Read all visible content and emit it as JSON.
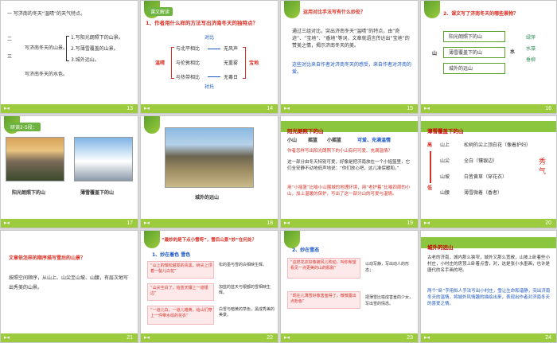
{
  "slides": [
    {
      "num": "13",
      "lines": [
        "一  写济南的冬天“温晴”的天气特点。",
        "二",
        "三",
        "写济南冬天的山景。",
        "1.写阳光朗照下的山景。",
        "2.写薄雪覆盖的山景。",
        "3.城外远山。",
        "写济南冬天的水色。"
      ]
    },
    {
      "num": "14",
      "tag": "课文解读",
      "question": "1、作者用什么样的方法写出济南冬天的独特点？",
      "center": "温晴",
      "rows": [
        "与北平相比",
        "与伦敦相比",
        "与热带相比"
      ],
      "results": [
        "无风声",
        "无重雾",
        "无毒日"
      ],
      "top": "对比",
      "bottom": "衬托",
      "right": "宝地"
    },
    {
      "num": "15",
      "title": "运用对比手法写有什么妙处？",
      "body1": "通过三组对比，突出济南冬天“温晴”的特点，由“奇迹”、“宝地”、“香地”等词，文章就语言传达出“宝地”的赞美之情，揭示济南冬天的美。",
      "body2": "这些对比来自作者对济南冬天的感受，来自作者对济南的爱。"
    },
    {
      "num": "16",
      "title": "2、课文写了济南冬天的哪些景物？",
      "items": [
        "阳光朗照下的山",
        "薄雪覆盖下的山",
        "城外的远山"
      ],
      "left": "山",
      "mid": "水",
      "right": [
        "绿萍",
        "水藻",
        "垂柳"
      ]
    },
    {
      "num": "17",
      "tag": "研读2-5段：",
      "cap1": "阳光朗照下的山",
      "cap2": "薄雪覆盖下的山"
    },
    {
      "num": "18",
      "cap": "城外的远山"
    },
    {
      "num": "19",
      "header": "阳光朗照下的山",
      "line1a": "小山",
      "line1b": "摇篮",
      "line1c": "小摇篮",
      "line1d": "可爱、充满温情",
      "q": "作者怎样写出阳光朗照下的小山有何可爱、充满温情？",
      "body": "这一部分由冬天特别可爱，好像是把济南放在一个小摇篮里，它们全安静不动地低声地说：“你们放心吧，这儿准保暖和。”",
      "note": "用“小摇篮”比喻小山围城的地理环境，用“老护着”比喻四周的小山，加上温暖的保护，写出了这一部分山的可爱与温情。"
    },
    {
      "num": "20",
      "header": "薄雪覆盖下的山",
      "rows": [
        [
          "山上",
          "松树的尖上顶白花（像着护妇）"
        ],
        [
          "山尖",
          "全白（镶银边）"
        ],
        [
          "山坡",
          "白皆黄草（穿花衣）"
        ],
        [
          "山腰",
          "薄雪微着（香者）"
        ]
      ],
      "left1": "高",
      "left2": "低",
      "right": "秀气"
    },
    {
      "num": "21",
      "q": "文章依怎样的顺序描写雪后的山景？",
      "a": "按照空间顺序，从山上、山尖至山坡、山腰，有层次地写出秀美的山景。"
    },
    {
      "num": "22",
      "tag": "“最妙的是下点小雪呀”，雪后山景“妙”在何处？",
      "sub": "1、妙在着色  雪色",
      "p1": "“山上的矮松越发的青黑，树尖上顶着一髻儿白花”",
      "r1": "松的墨与雪的白相映生辉。",
      "p2": "“山尖全白了，给蓝天镶上一道银边”",
      "r2": "加蓝的蓝天与银都的雪相映生辉。",
      "p3": "“一道儿白，一道儿暗黄，给山们穿上一件带水纹的花衣”",
      "r3": "白雪与暗黄的草色，黑成秀美的美景。"
    },
    {
      "num": "23",
      "sub": "2、妙在雪态",
      "p1": "“这样花衣好像被风儿吹动，叫你希望看见一点更美的山的肌肤”",
      "r1": "以动写静，写出动人的形态；",
      "p2": "“现在儿薄雪好像害羞得了，微微露出点粉色”",
      "r2": "把薄雪比喻成害羞的少女，写出雪的情态。"
    },
    {
      "num": "24",
      "header": "城外的远山",
      "body1": "古老的济南，城内那么狭窄，城外又那么宽敞，山坡上卧着些小村庄，小村庄的房顶上卧着点雪，对，这是张小水墨画，也许是唐代的名手画的吧。",
      "body2": "两个“卧”字用拟人手法写出小村庄，雪让生命和谐静，突出济南冬天的温情，将城外风情趣的描绘出来，表现出作者对济南冬天的喜爱之情。"
    }
  ],
  "colors": {
    "accent": "#9ccc3d",
    "leaf": "#5aa02c",
    "red": "#d93025",
    "blue": "#1a56c4"
  }
}
